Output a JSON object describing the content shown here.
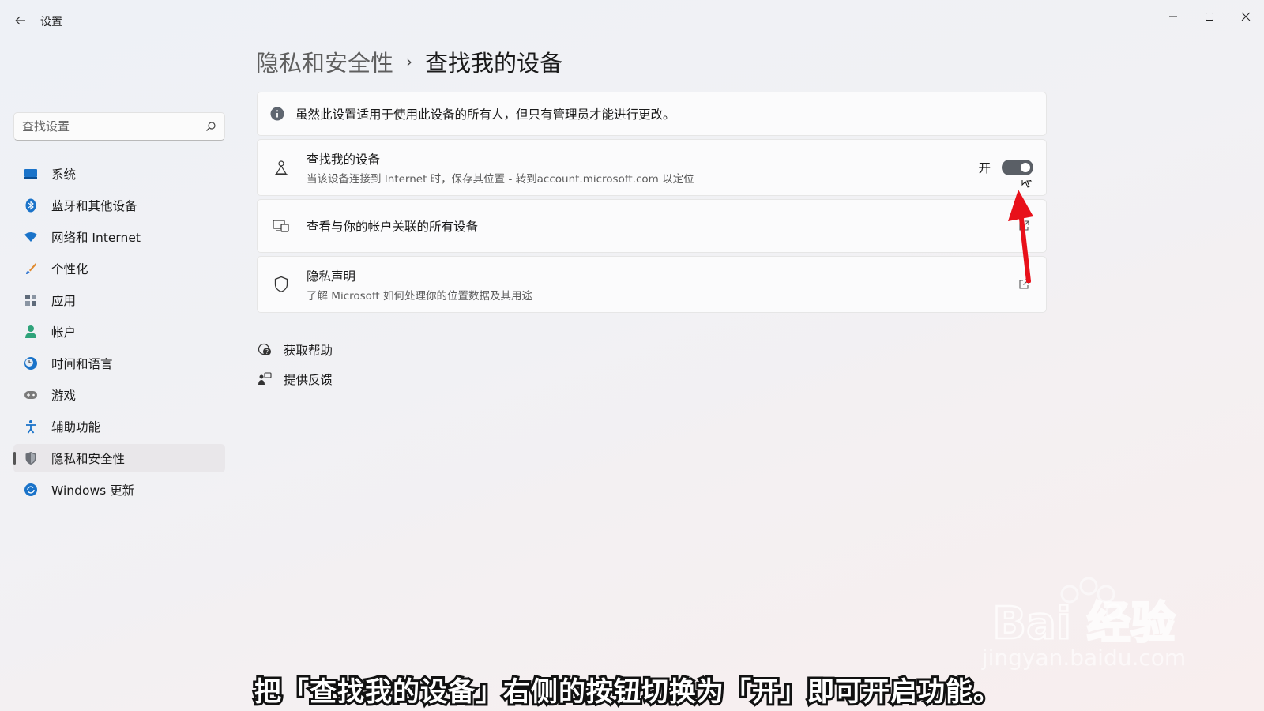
{
  "window": {
    "title": "设置"
  },
  "sidebar": {
    "search_placeholder": "查找设置",
    "items": [
      {
        "label": "系统",
        "icon": "monitor-icon",
        "color": "#1a73c9"
      },
      {
        "label": "蓝牙和其他设备",
        "icon": "bluetooth-icon",
        "color": "#1a73c9"
      },
      {
        "label": "网络和 Internet",
        "icon": "wifi-icon",
        "color": "#1a73c9"
      },
      {
        "label": "个性化",
        "icon": "brush-icon",
        "color": "#e08a2e"
      },
      {
        "label": "应用",
        "icon": "apps-icon",
        "color": "#5f6b7a"
      },
      {
        "label": "帐户",
        "icon": "account-icon",
        "color": "#2fa37a"
      },
      {
        "label": "时间和语言",
        "icon": "clock-globe-icon",
        "color": "#1a73c9"
      },
      {
        "label": "游戏",
        "icon": "gamepad-icon",
        "color": "#7a7a7a"
      },
      {
        "label": "辅助功能",
        "icon": "accessibility-icon",
        "color": "#1a73c9"
      },
      {
        "label": "隐私和安全性",
        "icon": "shield-icon",
        "color": "#6b6f76",
        "active": true
      },
      {
        "label": "Windows 更新",
        "icon": "update-icon",
        "color": "#1a73c9"
      }
    ]
  },
  "breadcrumb": {
    "parent": "隐私和安全性",
    "separator": "›",
    "current": "查找我的设备"
  },
  "info_banner": {
    "text": "虽然此设置适用于使用此设备的所有人，但只有管理员才能进行更改。"
  },
  "find_my_device": {
    "title": "查找我的设备",
    "subtitle": "当该设备连接到 Internet 时，保存其位置 - 转到account.microsoft.com 以定位",
    "toggle_label": "开",
    "toggle_on": true
  },
  "linked_devices": {
    "title": "查看与你的帐户关联的所有设备"
  },
  "privacy_statement": {
    "title": "隐私声明",
    "subtitle": "了解 Microsoft 如何处理你的位置数据及其用途"
  },
  "help": {
    "get_help": "获取帮助",
    "feedback": "提供反馈"
  },
  "overlay": {
    "caption": "把「查找我的设备」右侧的按钮切换为「开」即可开启功能。",
    "watermark_brand": "Bai 经验",
    "watermark_url": "jingyan.baidu.com",
    "arrow_color": "#e8101a"
  }
}
